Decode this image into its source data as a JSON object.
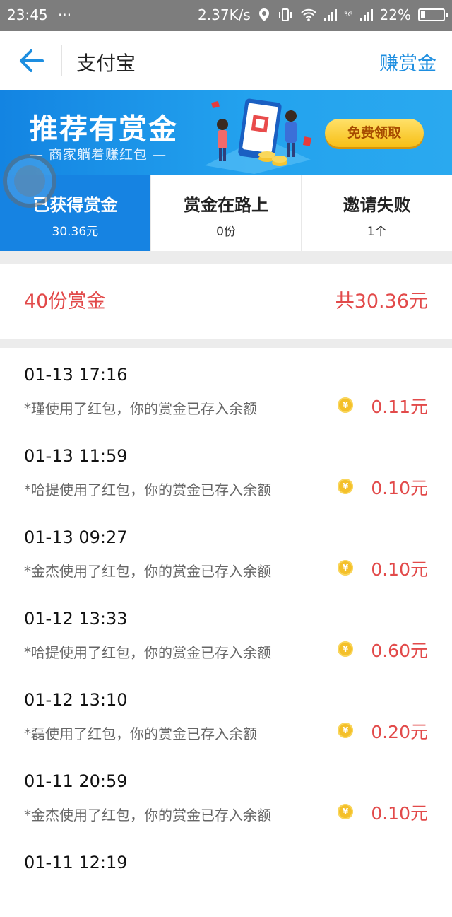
{
  "status_bar": {
    "time": "23:45",
    "dots": "···",
    "speed": "2.37K/s",
    "network": "3G",
    "battery": "22%",
    "battery_level": 0.22
  },
  "nav": {
    "title": "支付宝",
    "action": "赚赏金"
  },
  "banner": {
    "title": "推荐有赏金",
    "subtitle": "— 商家躺着赚红包 —",
    "button": "免费领取"
  },
  "tabs": [
    {
      "label": "已获得赏金",
      "value": "30.36元",
      "active": true
    },
    {
      "label": "赏金在路上",
      "value": "0份",
      "active": false
    },
    {
      "label": "邀请失败",
      "value": "1个",
      "active": false
    }
  ],
  "summary": {
    "count": "40份赏金",
    "total": "共30.36元"
  },
  "records": [
    {
      "time": "01-13 17:16",
      "desc": "*瑾使用了红包，你的赏金已存入余额",
      "amount": "0.11元"
    },
    {
      "time": "01-13 11:59",
      "desc": "*哈提使用了红包，你的赏金已存入余额",
      "amount": "0.10元"
    },
    {
      "time": "01-13 09:27",
      "desc": "*金杰使用了红包，你的赏金已存入余额",
      "amount": "0.10元"
    },
    {
      "time": "01-12 13:33",
      "desc": "*哈提使用了红包，你的赏金已存入余额",
      "amount": "0.60元"
    },
    {
      "time": "01-12 13:10",
      "desc": "*磊使用了红包，你的赏金已存入余额",
      "amount": "0.20元"
    },
    {
      "time": "01-11 20:59",
      "desc": "*金杰使用了红包，你的赏金已存入余额",
      "amount": "0.10元"
    },
    {
      "time": "01-11 12:19",
      "desc": "",
      "amount": ""
    }
  ],
  "colors": {
    "primary_blue": "#1683e2",
    "accent_red": "#e24a4a",
    "coin_gold": "#f4c02a"
  }
}
